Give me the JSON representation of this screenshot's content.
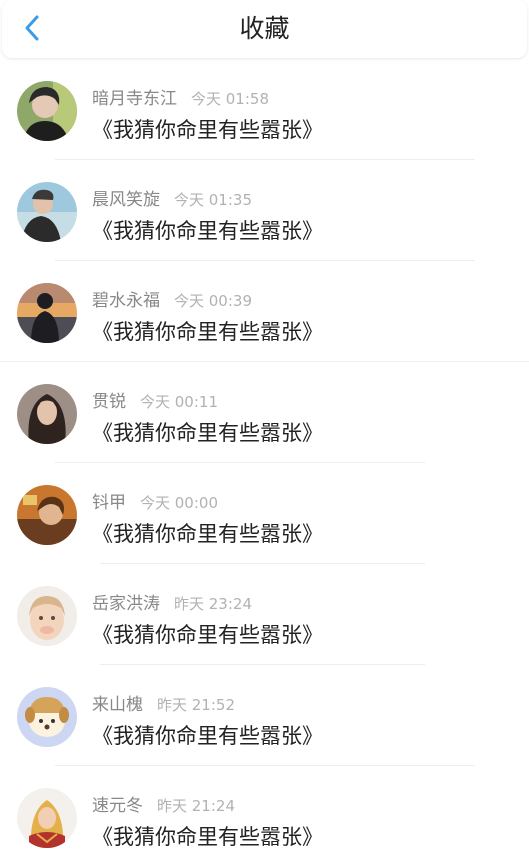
{
  "header": {
    "title": "收藏"
  },
  "items": [
    {
      "name": "暗月寺东江",
      "time": "今天 01:58",
      "message": "《我猜你命里有些嚣张》"
    },
    {
      "name": "晨风笑旋",
      "time": "今天 01:35",
      "message": "《我猜你命里有些嚣张》"
    },
    {
      "name": "碧水永福",
      "time": "今天 00:39",
      "message": "《我猜你命里有些嚣张》"
    },
    {
      "name": "贯锐",
      "time": "今天 00:11",
      "message": "《我猜你命里有些嚣张》"
    },
    {
      "name": "钭甲",
      "time": "今天 00:00",
      "message": "《我猜你命里有些嚣张》"
    },
    {
      "name": "岳家洪涛",
      "time": "昨天 23:24",
      "message": "《我猜你命里有些嚣张》"
    },
    {
      "name": "来山槐",
      "time": "昨天 21:52",
      "message": "《我猜你命里有些嚣张》"
    },
    {
      "name": "速元冬",
      "time": "昨天 21:24",
      "message": "《我猜你命里有些嚣张》"
    }
  ],
  "icons": {
    "back": "chevron-left-icon"
  },
  "colors": {
    "accent": "#3a9be8",
    "name_text": "#888888",
    "time_text": "#b2b2b2",
    "divider": "#eeeeee"
  }
}
